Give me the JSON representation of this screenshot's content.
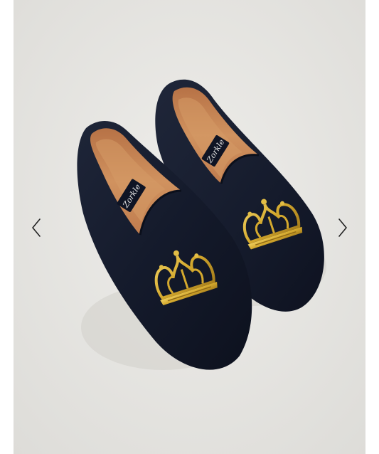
{
  "viewer": {
    "prev_icon": "chevron-left-icon",
    "next_icon": "chevron-right-icon"
  },
  "photo": {
    "brand_label": "Zorkle",
    "colors": {
      "background": "#e7e6e2",
      "velvet": "#141a2c",
      "lining": "#c8875a",
      "embroidery": "#d8b43a"
    }
  }
}
